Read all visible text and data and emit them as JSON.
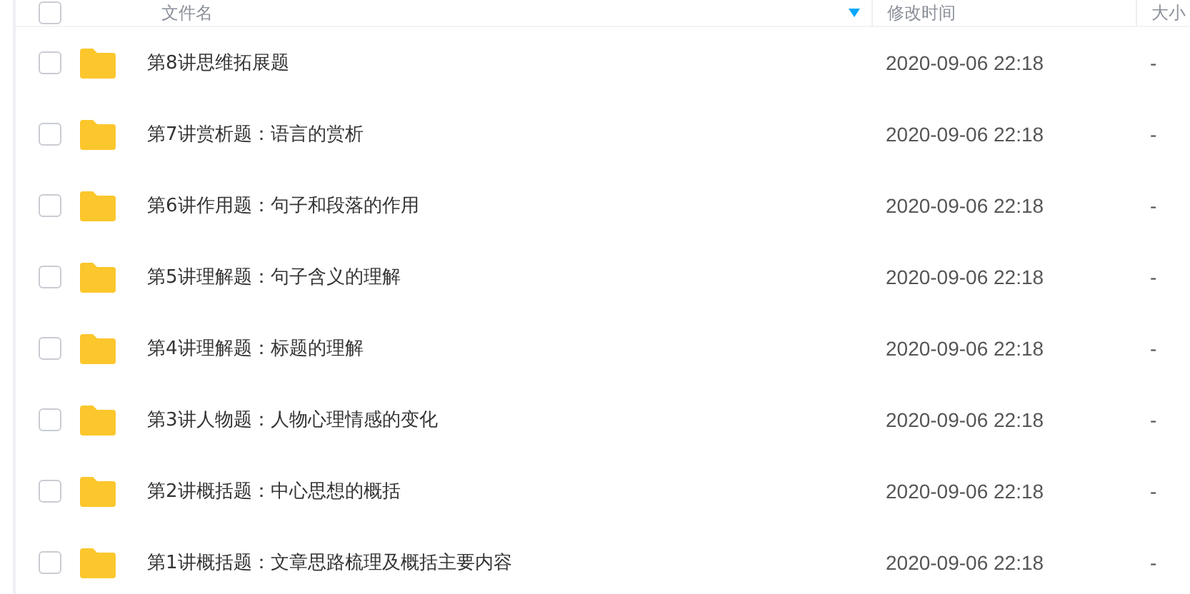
{
  "table": {
    "columns": [
      {
        "label": "文件名",
        "sorted": true
      },
      {
        "label": "修改时间",
        "sorted": false
      },
      {
        "label": "大小",
        "sorted": false
      }
    ],
    "all_checked": false,
    "rows": [
      {
        "name": "第8讲思维拓展题",
        "modified": "2020-09-06 22:18",
        "size": "-",
        "checked": false
      },
      {
        "name": "第7讲赏析题：语言的赏析",
        "modified": "2020-09-06 22:18",
        "size": "-",
        "checked": false
      },
      {
        "name": "第6讲作用题：句子和段落的作用",
        "modified": "2020-09-06 22:18",
        "size": "-",
        "checked": false
      },
      {
        "name": "第5讲理解题：句子含义的理解",
        "modified": "2020-09-06 22:18",
        "size": "-",
        "checked": false
      },
      {
        "name": "第4讲理解题：标题的理解",
        "modified": "2020-09-06 22:18",
        "size": "-",
        "checked": false
      },
      {
        "name": "第3讲人物题：人物心理情感的变化",
        "modified": "2020-09-06 22:18",
        "size": "-",
        "checked": false
      },
      {
        "name": "第2讲概括题：中心思想的概括",
        "modified": "2020-09-06 22:18",
        "size": "-",
        "checked": false
      },
      {
        "name": "第1讲概括题：文章思路梳理及概括主要内容",
        "modified": "2020-09-06 22:18",
        "size": "-",
        "checked": false
      }
    ]
  }
}
